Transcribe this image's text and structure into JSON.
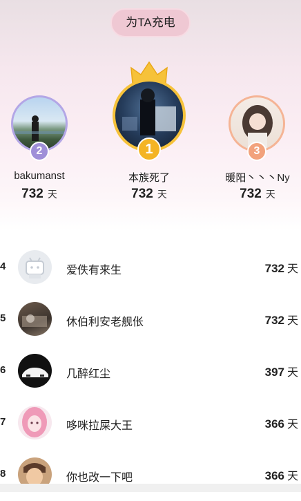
{
  "charge_button": {
    "label": "为TA充电"
  },
  "podium": [
    {
      "rank": "2",
      "name": "bakumanst",
      "days": "732",
      "unit": "天",
      "color": "#9f8fd8"
    },
    {
      "rank": "1",
      "name": "本族死了",
      "days": "732",
      "unit": "天",
      "color": "#f4b424"
    },
    {
      "rank": "3",
      "name": "暖阳丶丶丶Ny",
      "days": "732",
      "unit": "天",
      "color": "#f2a27c"
    }
  ],
  "list": [
    {
      "rank": "4",
      "name": "爱佚有来生",
      "days": "732",
      "unit": "天",
      "avatar": "bilibili-default-avatar"
    },
    {
      "rank": "5",
      "name": "休伯利安老舰伥",
      "days": "732",
      "unit": "天",
      "avatar": "room-photo-avatar"
    },
    {
      "rank": "6",
      "name": "几醉红尘",
      "days": "397",
      "unit": "天",
      "avatar": "white-sports-car-avatar"
    },
    {
      "rank": "7",
      "name": "哆咪拉屎大王",
      "days": "366",
      "unit": "天",
      "avatar": "pink-hair-girl-avatar"
    },
    {
      "rank": "8",
      "name": "你也改一下吧",
      "days": "366",
      "unit": "天",
      "avatar": "anime-man-avatar"
    }
  ]
}
